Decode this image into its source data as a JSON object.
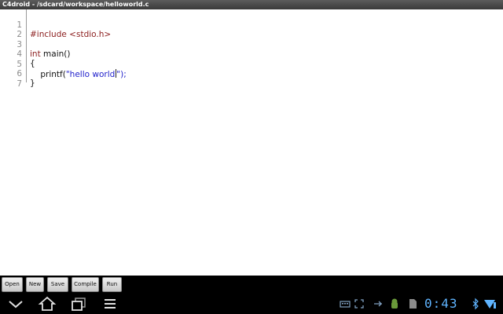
{
  "window": {
    "title": "C4droid - /sdcard/workspace/helloworld.c"
  },
  "editor": {
    "lines": [
      {
        "num": "1",
        "pre": "",
        "kw": "#include <stdio.h>",
        "mid": "",
        "str": "",
        "post": ""
      },
      {
        "num": "2",
        "pre": "",
        "kw": "",
        "mid": "",
        "str": "",
        "post": ""
      },
      {
        "num": "3",
        "pre": "",
        "kw": "int",
        "mid": " main()",
        "str": "",
        "post": ""
      },
      {
        "num": "4",
        "pre": "{",
        "kw": "",
        "mid": "",
        "str": "",
        "post": ""
      },
      {
        "num": "5",
        "pre": "    printf(",
        "kw": "",
        "mid": "",
        "str": "\"hello world",
        "post": "\");"
      },
      {
        "num": "6",
        "pre": "}",
        "kw": "",
        "mid": "",
        "str": "",
        "post": ""
      },
      {
        "num": "7",
        "pre": "",
        "kw": "",
        "mid": "",
        "str": "",
        "post": ""
      }
    ]
  },
  "toolbar": {
    "open": "Open",
    "new": "New",
    "save": "Save",
    "compile": "Compile",
    "run": "Run"
  },
  "system_bar": {
    "clock": "0:43",
    "icons": [
      "back-icon",
      "home-icon",
      "recent-apps-icon",
      "menu-icon",
      "keyboard-icon",
      "fullscreen-icon",
      "usb-icon",
      "android-icon",
      "sd-card-icon",
      "bluetooth-icon",
      "wifi-icon"
    ]
  },
  "colors": {
    "keyword": "#8b1d1d",
    "string": "#2222cc",
    "clock": "#5fb4ff"
  }
}
